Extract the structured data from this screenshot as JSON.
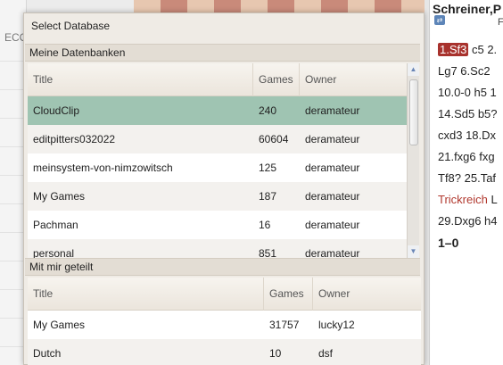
{
  "background": {
    "eco_label": "ECO",
    "player_name": "Schreiner,P",
    "sub_label": "F",
    "moves": [
      {
        "hl": "1.Sf3",
        "rest": " c5 2."
      },
      {
        "text": "Lg7 6.Sc2"
      },
      {
        "text": "10.0-0 h5 1"
      },
      {
        "text": "14.Sd5 b5?"
      },
      {
        "text": "cxd3 18.Dx"
      },
      {
        "text": "21.fxg6 fxg"
      },
      {
        "text": "Tf8? 25.Taf"
      },
      {
        "red": "Trickreich",
        "rest": " L"
      },
      {
        "text": "29.Dxg6 h4"
      }
    ],
    "result": "1–0"
  },
  "dialog": {
    "title": "Select Database",
    "my_section": {
      "label": "Meine Datenbanken",
      "columns": [
        "Title",
        "Games",
        "Owner"
      ],
      "rows": [
        {
          "title": "CloudClip",
          "games": "240",
          "owner": "deramateur",
          "selected": true
        },
        {
          "title": "editpitters032022",
          "games": "60604",
          "owner": "deramateur"
        },
        {
          "title": "meinsystem-von-nimzowitsch",
          "games": "125",
          "owner": "deramateur"
        },
        {
          "title": "My Games",
          "games": "187",
          "owner": "deramateur"
        },
        {
          "title": "Pachman",
          "games": "16",
          "owner": "deramateur"
        },
        {
          "title": "personal",
          "games": "851",
          "owner": "deramateur"
        }
      ],
      "scroll_up_icon": "triangle-up",
      "scroll_down_icon": "triangle-down"
    },
    "shared_section": {
      "label": "Mit mir geteilt",
      "columns": [
        "Title",
        "Games",
        "Owner"
      ],
      "rows": [
        {
          "title": "My Games",
          "games": "31757",
          "owner": "lucky12"
        },
        {
          "title": "Dutch",
          "games": "10",
          "owner": "dsf"
        }
      ]
    }
  },
  "colors": {
    "selected_row": "#9fc4b2",
    "move_highlight": "#a8322d",
    "annotation_red": "#b1382e",
    "dialog_bg": "#efebe5"
  }
}
